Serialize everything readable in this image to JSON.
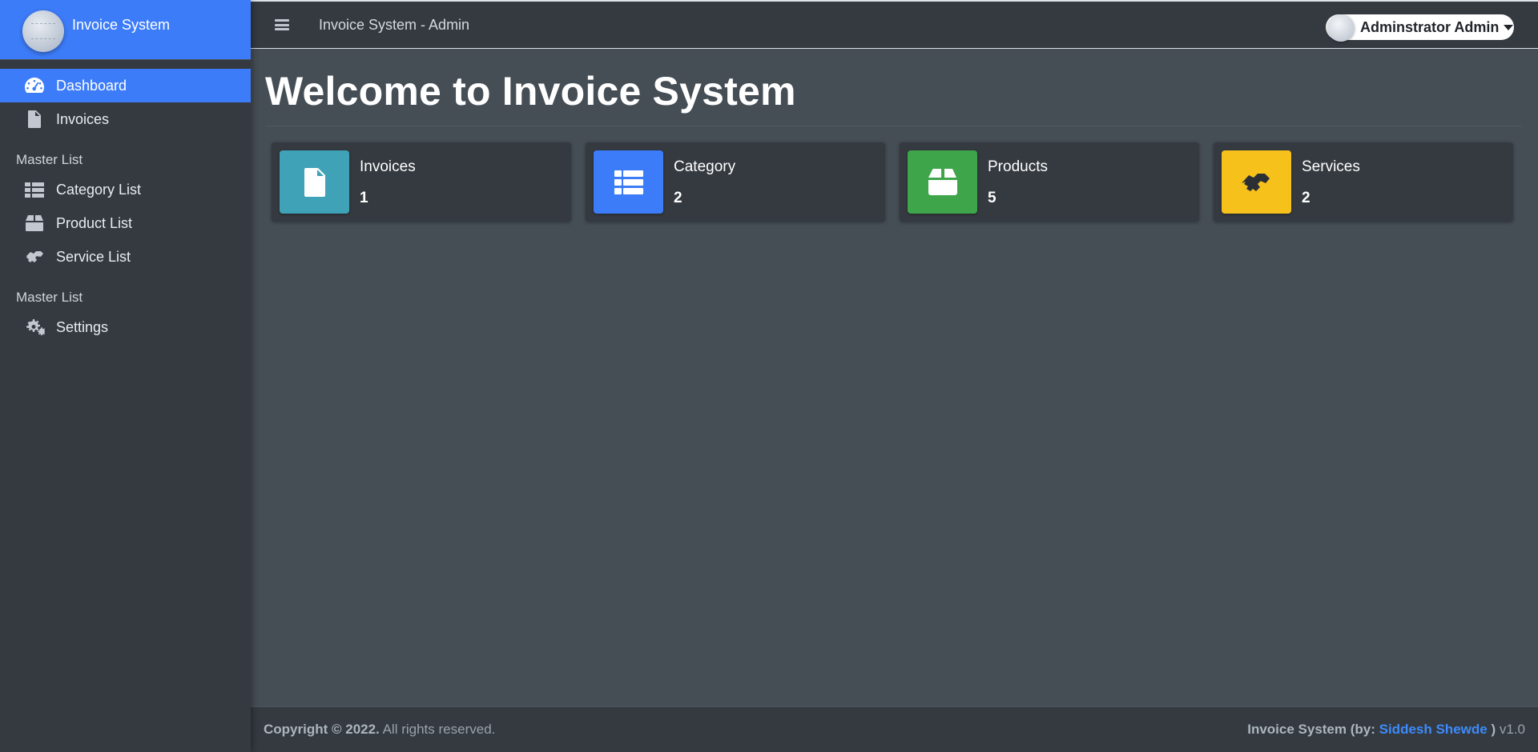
{
  "brand": {
    "name": "Invoice System"
  },
  "sidebar": {
    "items": [
      {
        "label": "Dashboard",
        "icon": "tachometer-icon",
        "active": true
      },
      {
        "label": "Invoices",
        "icon": "file-invoice-icon"
      }
    ],
    "sections": [
      {
        "header": "Master List",
        "items": [
          {
            "label": "Category List",
            "icon": "table-list-icon"
          },
          {
            "label": "Product List",
            "icon": "box-icon"
          },
          {
            "label": "Service List",
            "icon": "handshake-icon"
          }
        ]
      },
      {
        "header": "Master List",
        "items": [
          {
            "label": "Settings",
            "icon": "cogs-icon"
          }
        ]
      }
    ]
  },
  "topbar": {
    "title": "Invoice System - Admin",
    "user_name": "Adminstrator Admin"
  },
  "main": {
    "title": "Welcome to Invoice System",
    "cards": [
      {
        "label": "Invoices",
        "value": "1",
        "icon": "file-invoice-icon",
        "color": "#3fa2b7"
      },
      {
        "label": "Category",
        "value": "2",
        "icon": "table-list-icon",
        "color": "#3d7cf9"
      },
      {
        "label": "Products",
        "value": "5",
        "icon": "box-icon",
        "color": "#3fa54a"
      },
      {
        "label": "Services",
        "value": "2",
        "icon": "handshake-icon",
        "color": "#f7c11c"
      }
    ]
  },
  "footer": {
    "copyright": "Copyright © 2022.",
    "rights": "All rights reserved.",
    "app": "Invoice System (by:",
    "author": "Siddesh Shewde",
    "close_paren": ")",
    "version": "v1.0"
  },
  "colors": {
    "accent": "#3d7cf9",
    "sidebar_bg": "#343a40",
    "content_bg": "#454d55"
  }
}
